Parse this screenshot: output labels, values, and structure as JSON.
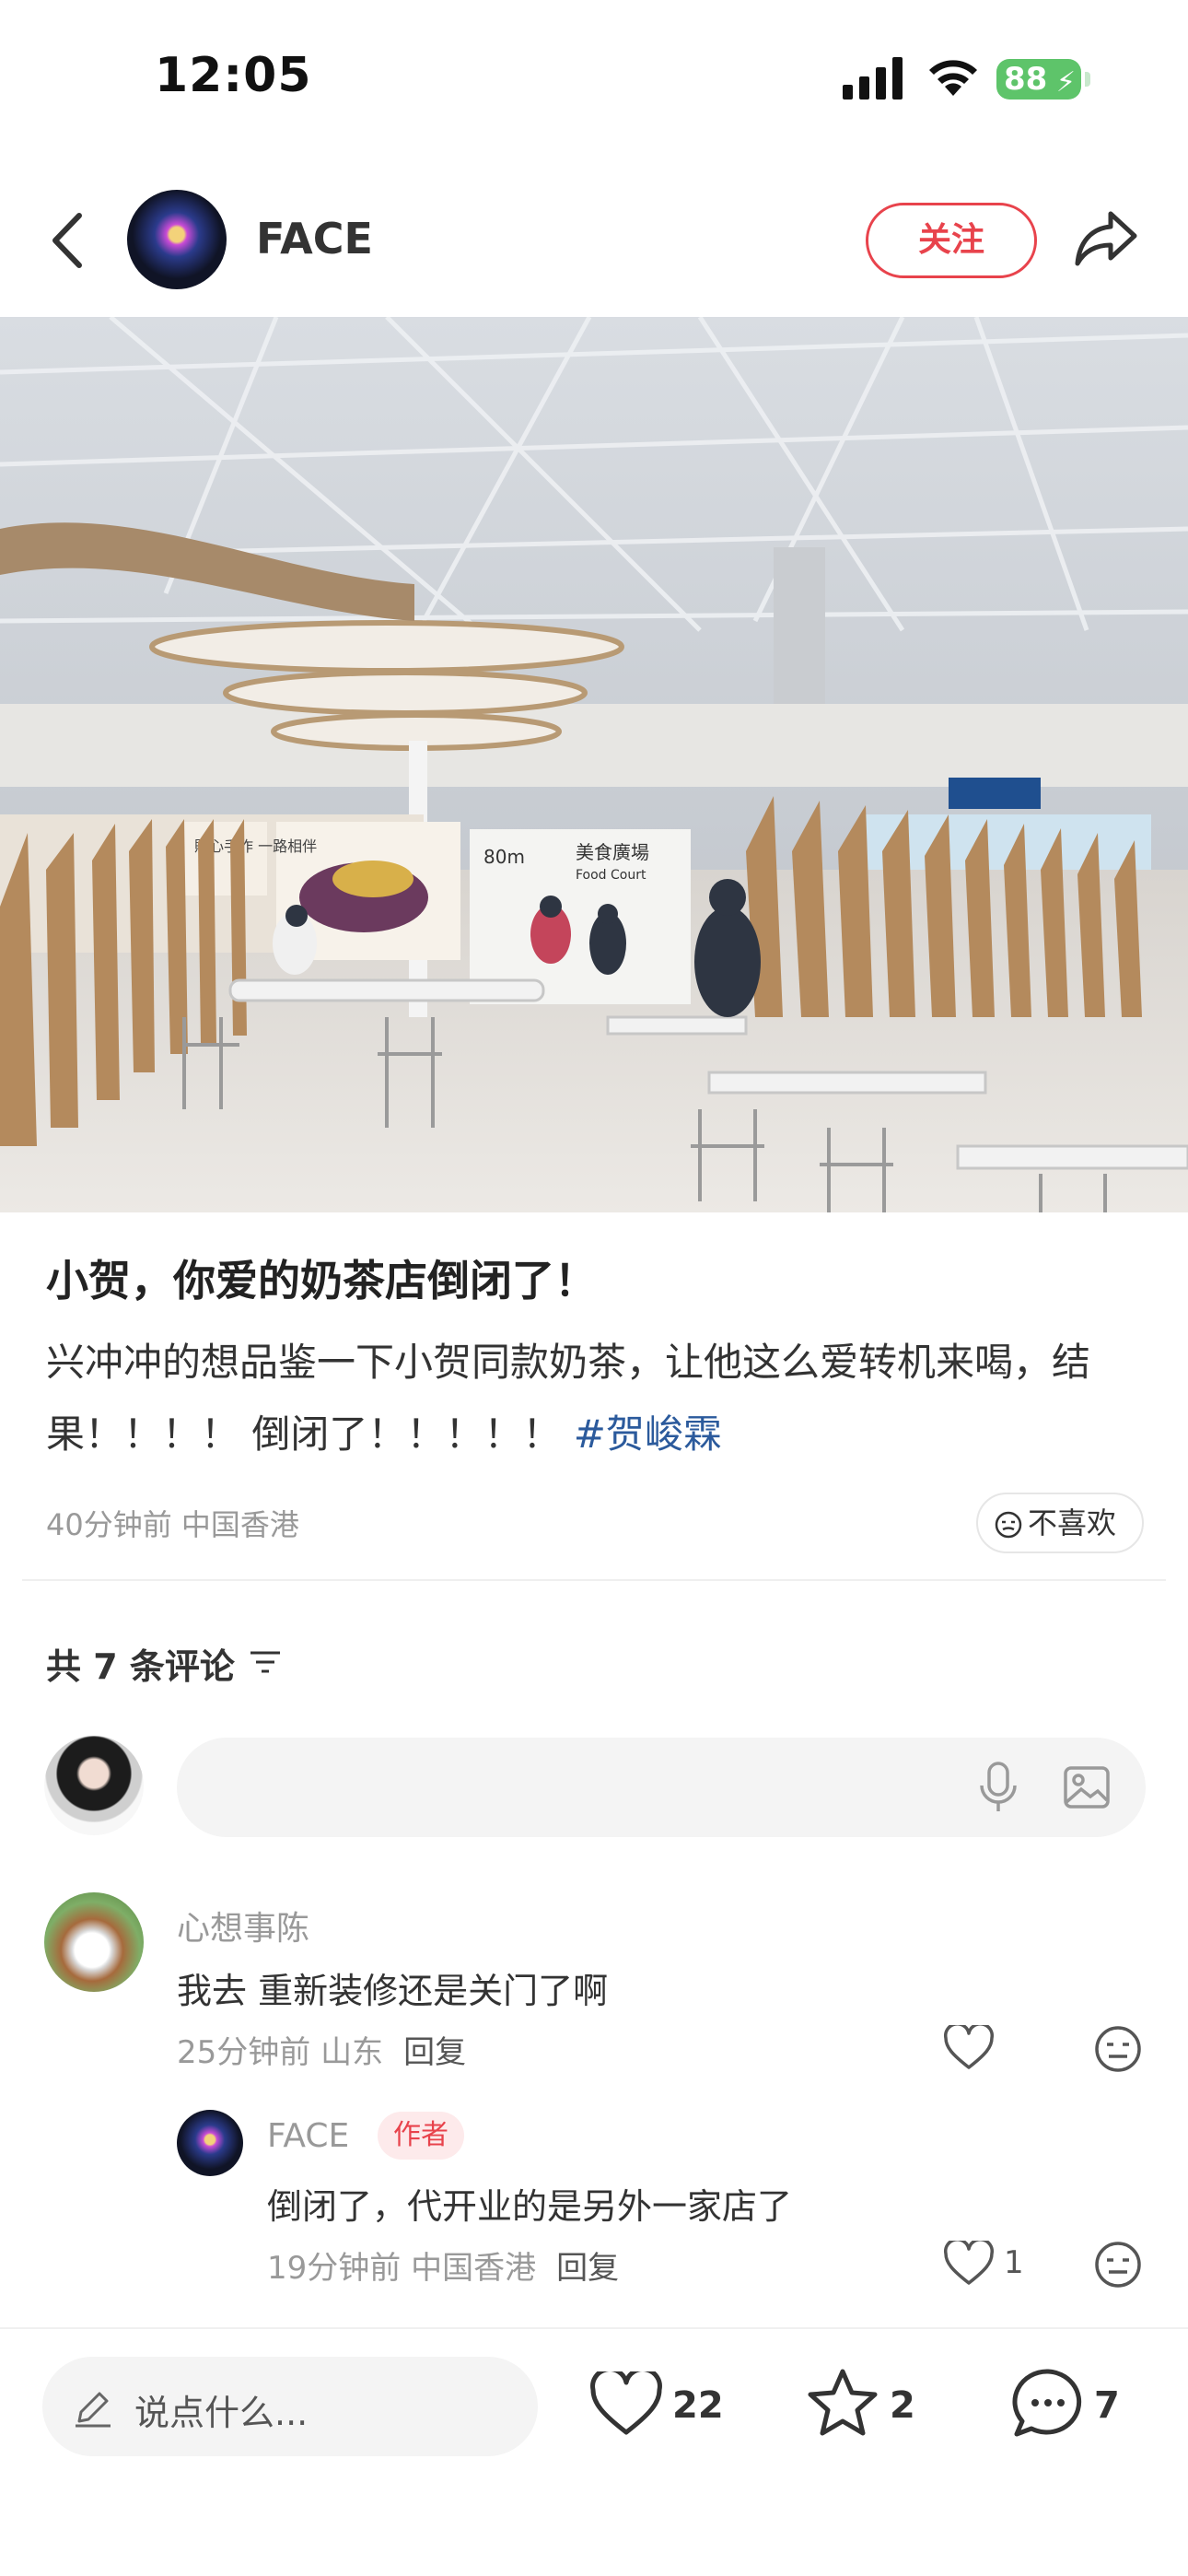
{
  "status_bar": {
    "time": "12:05",
    "battery": "88"
  },
  "header": {
    "author": "FACE",
    "follow_label": "关注"
  },
  "post": {
    "title": "小贺，你爱的奶茶店倒闭了！",
    "body": "兴冲冲的想品鉴一下小贺同款奶茶，让他这么爱转机来喝，结果！！！！ 倒闭了！！！！！ ",
    "hashtag": "#贺峻霖",
    "meta": "40分钟前 中国香港",
    "dislike_label": "不喜欢",
    "photo_signs": {
      "distance": "80m",
      "food_court_cn": "美食廣場",
      "food_court_en": "Food Court",
      "poster": "貼心手作 一路相伴"
    }
  },
  "comments_section": {
    "count_label": "共 7 条评论"
  },
  "comments": [
    {
      "name": "心想事陈",
      "text": "我去 重新装修还是关门了啊",
      "meta": "25分钟前 山东",
      "reply_label": "回复"
    }
  ],
  "reply": {
    "name": "FACE",
    "badge": "作者",
    "text": "倒闭了，代开业的是另外一家店了",
    "meta": "19分钟前 中国香港",
    "reply_label": "回复",
    "likes": "1"
  },
  "bottom_bar": {
    "placeholder": "说点什么...",
    "likes": "22",
    "stars": "2",
    "comments": "7"
  },
  "colors": {
    "accent": "#e8434c",
    "hashtag": "#2b5a9c",
    "battery": "#5ec46a"
  },
  "icons": [
    "back-icon",
    "share-icon",
    "signal-icon",
    "wifi-icon",
    "mic-icon",
    "image-icon",
    "heart-icon",
    "star-icon",
    "comment-icon",
    "pen-icon",
    "meh-face-icon",
    "sort-icon"
  ]
}
